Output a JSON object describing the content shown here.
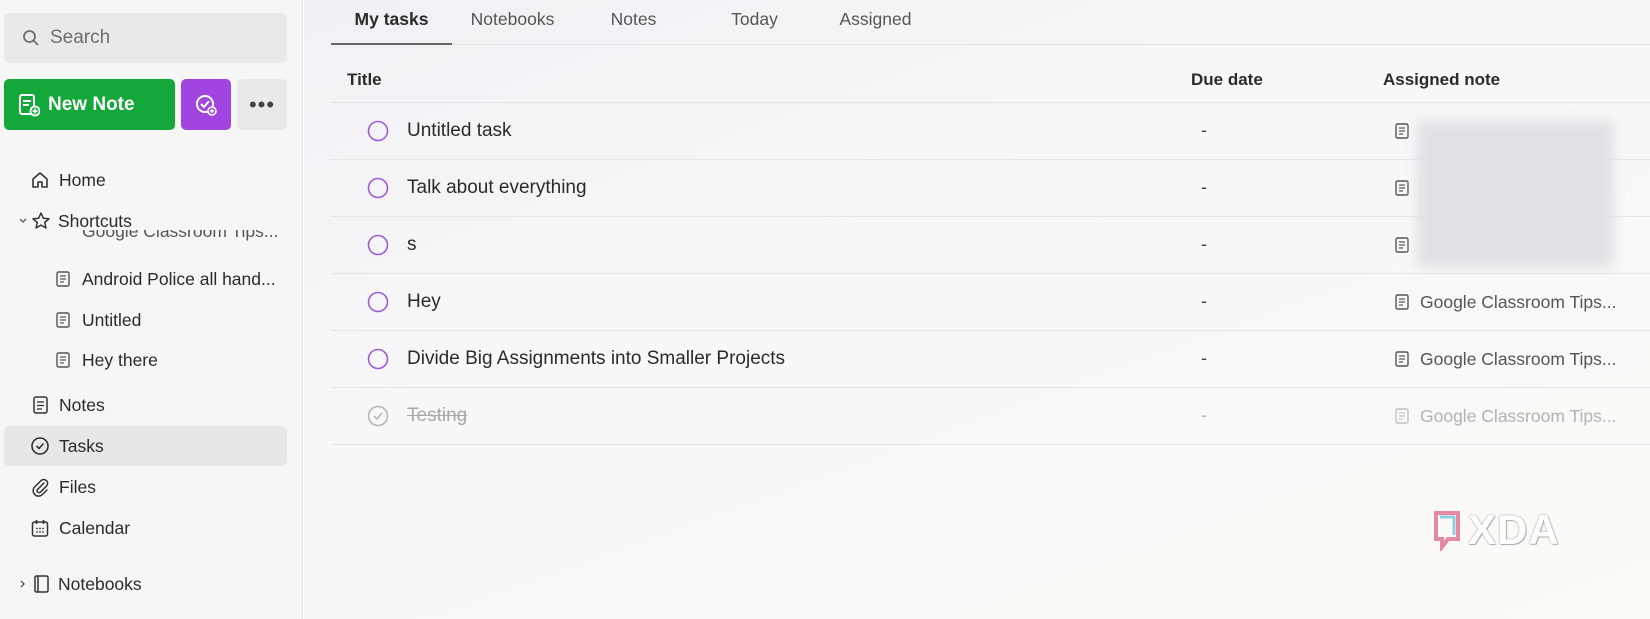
{
  "sidebar": {
    "search_placeholder": "Search",
    "new_note_label": "New Note",
    "more_label": "•••",
    "nav": {
      "home": "Home",
      "shortcuts": "Shortcuts",
      "notes": "Notes",
      "tasks": "Tasks",
      "files": "Files",
      "calendar": "Calendar",
      "notebooks": "Notebooks"
    },
    "shortcut_items": [
      "Google Classroom Tips...",
      "Android Police all hand...",
      "Untitled",
      "Hey there"
    ]
  },
  "tabs": [
    "My tasks",
    "Notebooks",
    "Notes",
    "Today",
    "Assigned"
  ],
  "active_tab": "My tasks",
  "table": {
    "headers": {
      "title": "Title",
      "due_date": "Due date",
      "assigned_note": "Assigned note"
    },
    "rows": [
      {
        "title": "Untitled task",
        "due": "-",
        "note": "",
        "done": false
      },
      {
        "title": "Talk about everything",
        "due": "-",
        "note": "",
        "done": false
      },
      {
        "title": "s",
        "due": "-",
        "note": "",
        "done": false
      },
      {
        "title": "Hey",
        "due": "-",
        "note": "Google Classroom Tips...",
        "done": false
      },
      {
        "title": "Divide Big Assignments into Smaller Projects",
        "due": "-",
        "note": "Google Classroom Tips...",
        "done": false
      },
      {
        "title": "Testing",
        "due": "-",
        "note": "Google Classroom Tips...",
        "done": true
      }
    ]
  },
  "watermark": "XDA",
  "colors": {
    "new_note_green": "#14a83a",
    "task_purple": "#a045e0",
    "checkbox_purple": "#9b5cd6"
  }
}
